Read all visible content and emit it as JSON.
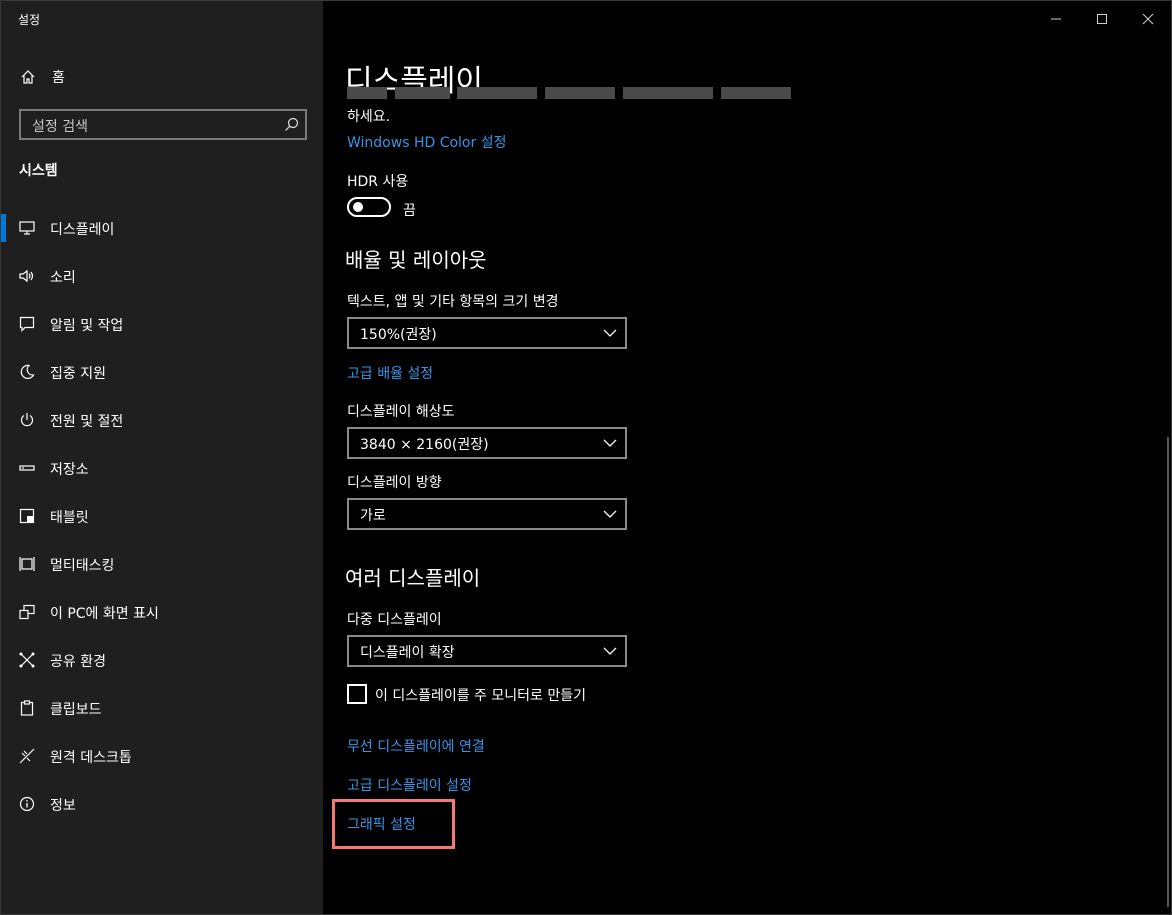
{
  "app": {
    "title": "설정"
  },
  "sidebar": {
    "home_label": "홈",
    "search_placeholder": "설정 검색",
    "section_label": "시스템",
    "items": [
      {
        "label": "디스플레이",
        "icon": "monitor-icon",
        "selected": true
      },
      {
        "label": "소리",
        "icon": "speaker-icon",
        "selected": false
      },
      {
        "label": "알림 및 작업",
        "icon": "message-icon",
        "selected": false
      },
      {
        "label": "집중 지원",
        "icon": "moon-icon",
        "selected": false
      },
      {
        "label": "전원 및 절전",
        "icon": "power-icon",
        "selected": false
      },
      {
        "label": "저장소",
        "icon": "storage-icon",
        "selected": false
      },
      {
        "label": "태블릿",
        "icon": "tablet-icon",
        "selected": false
      },
      {
        "label": "멀티태스킹",
        "icon": "multitasking-icon",
        "selected": false
      },
      {
        "label": "이 PC에 화면 표시",
        "icon": "project-icon",
        "selected": false
      },
      {
        "label": "공유 환경",
        "icon": "share-icon",
        "selected": false
      },
      {
        "label": "클립보드",
        "icon": "clipboard-icon",
        "selected": false
      },
      {
        "label": "원격 데스크톱",
        "icon": "remote-desktop-icon",
        "selected": false
      },
      {
        "label": "정보",
        "icon": "info-icon",
        "selected": false
      }
    ]
  },
  "main": {
    "page_title": "디스플레이",
    "hdr_desc_tail": "하세요.",
    "hdr_color_link": "Windows HD Color 설정",
    "hdr_label": "HDR 사용",
    "hdr_state": "끔",
    "scale_heading": "배율 및 레이아웃",
    "scale_label": "텍스트, 앱 및 기타 항목의 크기 변경",
    "scale_value": "150%(권장)",
    "advanced_scaling_link": "고급 배율 설정",
    "resolution_label": "디스플레이 해상도",
    "resolution_value": "3840 × 2160(권장)",
    "orientation_label": "디스플레이 방향",
    "orientation_value": "가로",
    "multi_heading": "여러 디스플레이",
    "multi_label": "다중 디스플레이",
    "multi_value": "디스플레이 확장",
    "main_display_checkbox": "이 디스플레이를 주 모니터로 만들기",
    "main_display_checked": false,
    "wireless_link": "무선 디스플레이에 연결",
    "advanced_display_link": "고급 디스플레이 설정",
    "graphics_link": "그래픽 설정"
  },
  "colors": {
    "accent": "#0078d7",
    "link": "#3794e6",
    "highlight": "#f17a7a",
    "sidebar_bg": "#1f1f1f",
    "main_bg": "#000000"
  }
}
